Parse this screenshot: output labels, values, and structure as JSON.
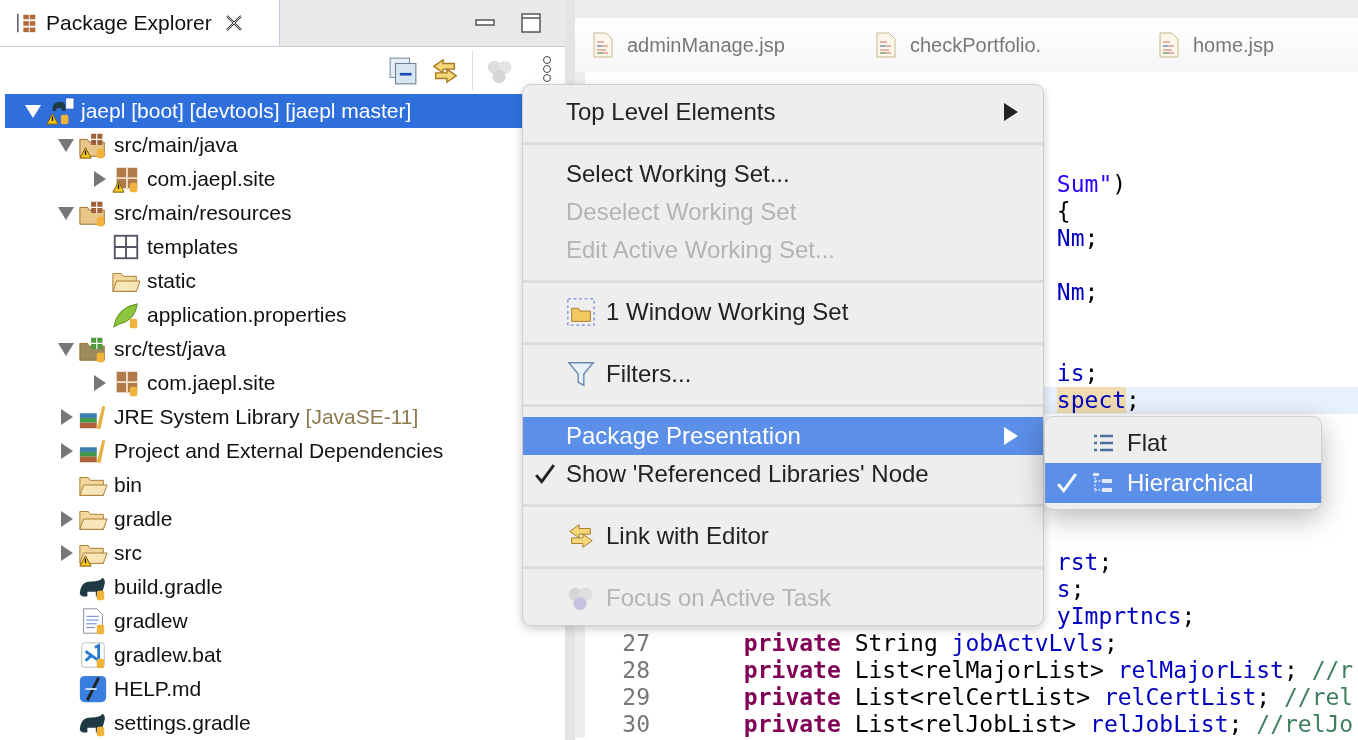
{
  "explorer": {
    "title": "Package Explorer",
    "tree": [
      {
        "label": "jaepl [boot] [devtools] [jaepl master]",
        "kind": "project",
        "warning": true,
        "selected": true,
        "expanded": true,
        "children": [
          {
            "label": "src/main/java",
            "kind": "source-folder",
            "warning": true,
            "selected": false,
            "expanded": true,
            "children": [
              {
                "label": "com.jaepl.site",
                "kind": "package",
                "warning": true,
                "selected": false,
                "expanded": false
              }
            ]
          },
          {
            "label": "src/main/resources",
            "kind": "resource-folder",
            "warning": false,
            "selected": false,
            "expanded": true,
            "children": [
              {
                "label": "templates",
                "kind": "grid",
                "warning": false,
                "selected": false
              },
              {
                "label": "static",
                "kind": "folder",
                "warning": false,
                "selected": false
              },
              {
                "label": "application.properties",
                "kind": "properties",
                "warning": false,
                "selected": false
              }
            ]
          },
          {
            "label": "src/test/java",
            "kind": "test-folder",
            "warning": false,
            "selected": false,
            "expanded": true,
            "children": [
              {
                "label": "com.jaepl.site",
                "kind": "package",
                "warning": false,
                "selected": false,
                "expanded": false
              }
            ]
          },
          {
            "label": "JRE System Library",
            "suffix": "[JavaSE-11]",
            "kind": "library",
            "warning": false,
            "selected": false,
            "expanded": false
          },
          {
            "label": "Project and External Dependencies",
            "kind": "library",
            "warning": false,
            "selected": false,
            "expanded": false
          },
          {
            "label": "bin",
            "kind": "folder",
            "warning": false,
            "selected": false
          },
          {
            "label": "gradle",
            "kind": "folder",
            "warning": false,
            "selected": false,
            "expanded": false
          },
          {
            "label": "src",
            "kind": "folder",
            "warning": true,
            "selected": false,
            "expanded": false
          },
          {
            "label": "build.gradle",
            "kind": "gradle",
            "warning": false,
            "selected": false
          },
          {
            "label": "gradlew",
            "kind": "text-file",
            "warning": false,
            "selected": false
          },
          {
            "label": "gradlew.bat",
            "kind": "bat-file",
            "warning": false,
            "selected": false
          },
          {
            "label": "HELP.md",
            "kind": "markdown",
            "warning": false,
            "selected": false
          },
          {
            "label": "settings.gradle",
            "kind": "gradle",
            "warning": false,
            "selected": false
          }
        ]
      }
    ]
  },
  "editor": {
    "tabs": [
      {
        "label": "adminManage.jsp"
      },
      {
        "label": "checkPortfolio."
      },
      {
        "label": "home.jsp"
      }
    ],
    "lines": [
      {
        "kind": "blank"
      },
      {
        "kind": "blank"
      },
      {
        "kind": "blank"
      },
      {
        "kind": "fragment",
        "current": false,
        "tokens": [
          {
            "kind": "string",
            "text": "Sum\""
          },
          {
            "kind": "punct",
            "text": ")"
          }
        ]
      },
      {
        "kind": "fragment",
        "current": false,
        "tokens": [
          {
            "kind": "plain",
            "text": "{"
          }
        ]
      },
      {
        "kind": "fragment",
        "current": false,
        "tokens": [
          {
            "kind": "field",
            "text": "Nm"
          },
          {
            "kind": "punct",
            "text": ";"
          }
        ]
      },
      {
        "kind": "blank"
      },
      {
        "kind": "fragment",
        "current": false,
        "tokens": [
          {
            "kind": "field",
            "text": "Nm"
          },
          {
            "kind": "punct",
            "text": ";"
          }
        ]
      },
      {
        "kind": "blank"
      },
      {
        "kind": "blank"
      },
      {
        "kind": "fragment",
        "current": false,
        "tokens": [
          {
            "kind": "field",
            "text": "is"
          },
          {
            "kind": "punct",
            "text": ";"
          }
        ]
      },
      {
        "kind": "fragment",
        "current": true,
        "tokens": [
          {
            "kind": "occurrence",
            "text": "spect"
          },
          {
            "kind": "punct",
            "text": ";"
          }
        ]
      },
      {
        "kind": "blank"
      },
      {
        "kind": "blank"
      },
      {
        "kind": "blank"
      },
      {
        "kind": "blank"
      },
      {
        "kind": "blank"
      },
      {
        "kind": "fragment",
        "current": false,
        "tokens": [
          {
            "kind": "field",
            "text": "rst"
          },
          {
            "kind": "punct",
            "text": ";"
          }
        ]
      },
      {
        "kind": "fragment",
        "current": false,
        "tokens": [
          {
            "kind": "field",
            "text": "s"
          },
          {
            "kind": "punct",
            "text": ";"
          }
        ]
      },
      {
        "kind": "fragment",
        "current": false,
        "tokens": [
          {
            "kind": "field",
            "text": "yImprtncs"
          },
          {
            "kind": "punct",
            "text": ";"
          }
        ]
      },
      {
        "kind": "full",
        "number": "27",
        "current": false,
        "tokens": [
          {
            "kind": "keyword",
            "text": "private"
          },
          {
            "kind": "plain",
            "text": "String"
          },
          {
            "kind": "field",
            "text": "jobActvLvls"
          },
          {
            "kind": "punct",
            "text": ";"
          }
        ]
      },
      {
        "kind": "full",
        "number": "28",
        "current": false,
        "tokens": [
          {
            "kind": "keyword",
            "text": "private"
          },
          {
            "kind": "plain",
            "text": "List<relMajorList>"
          },
          {
            "kind": "field",
            "text": "relMajorList"
          },
          {
            "kind": "punct",
            "text": ";"
          },
          {
            "kind": "comment",
            "text": "//r"
          }
        ]
      },
      {
        "kind": "full",
        "number": "29",
        "current": false,
        "tokens": [
          {
            "kind": "keyword",
            "text": "private"
          },
          {
            "kind": "plain",
            "text": "List<relCertList>"
          },
          {
            "kind": "field",
            "text": "relCertList"
          },
          {
            "kind": "punct",
            "text": ";"
          },
          {
            "kind": "comment",
            "text": "//rel"
          }
        ]
      },
      {
        "kind": "full",
        "number": "30",
        "current": false,
        "tokens": [
          {
            "kind": "keyword",
            "text": "private"
          },
          {
            "kind": "plain",
            "text": "List<relJobList>"
          },
          {
            "kind": "field",
            "text": "relJobList"
          },
          {
            "kind": "punct",
            "text": ";"
          },
          {
            "kind": "comment",
            "text": "//relJo"
          }
        ]
      }
    ]
  },
  "menu": {
    "items": [
      {
        "kind": "item",
        "label": "Top Level Elements",
        "submenu": true,
        "disabled": false,
        "selected": false,
        "checked": false
      },
      {
        "kind": "separator"
      },
      {
        "kind": "item",
        "label": "Select Working Set...",
        "submenu": false,
        "disabled": false,
        "selected": false,
        "checked": false
      },
      {
        "kind": "item",
        "label": "Deselect Working Set",
        "submenu": false,
        "disabled": true,
        "selected": false,
        "checked": false
      },
      {
        "kind": "item",
        "label": "Edit Active Working Set...",
        "submenu": false,
        "disabled": true,
        "selected": false,
        "checked": false
      },
      {
        "kind": "separator"
      },
      {
        "kind": "working-set",
        "label": "1 Window Working Set",
        "submenu": false,
        "disabled": false,
        "selected": false,
        "checked": false
      },
      {
        "kind": "separator"
      },
      {
        "kind": "filter",
        "label": "Filters...",
        "submenu": false,
        "disabled": false,
        "selected": false,
        "checked": false
      },
      {
        "kind": "separator"
      },
      {
        "kind": "item",
        "label": "Package Presentation",
        "submenu": true,
        "disabled": false,
        "selected": true,
        "checked": false
      },
      {
        "kind": "item",
        "label": "Show 'Referenced Libraries' Node",
        "submenu": false,
        "disabled": false,
        "selected": false,
        "checked": true
      },
      {
        "kind": "separator"
      },
      {
        "kind": "link",
        "label": "Link with Editor",
        "submenu": false,
        "disabled": false,
        "selected": false,
        "checked": false
      },
      {
        "kind": "separator"
      },
      {
        "kind": "task",
        "label": "Focus on Active Task",
        "submenu": false,
        "disabled": true,
        "selected": false,
        "checked": false
      }
    ]
  },
  "submenu": {
    "items": [
      {
        "kind": "flat",
        "label": "Flat",
        "selected": false,
        "checked": false
      },
      {
        "kind": "hierarchy",
        "label": "Hierarchical",
        "selected": true,
        "checked": true
      }
    ]
  }
}
